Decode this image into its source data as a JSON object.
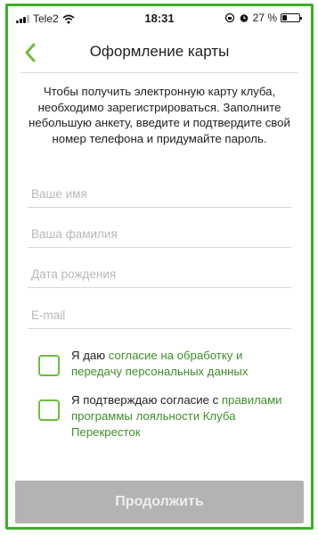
{
  "status_bar": {
    "carrier": "Tele2",
    "time": "18:31",
    "battery_percent": "27 %",
    "battery_level": 0.27,
    "icons": [
      "signal-icon",
      "wifi-icon",
      "rotation-lock-icon",
      "alarm-icon",
      "battery-icon"
    ]
  },
  "nav": {
    "title": "Оформление карты",
    "back_icon": "chevron-left-icon"
  },
  "intro_text": "Чтобы получить электронную карту клуба, необходимо зарегистрироваться. Заполните небольшую анкету, введите и подтвердите свой номер телефона и придумайте пароль.",
  "form": {
    "first_name": {
      "value": "",
      "placeholder": "Ваше имя"
    },
    "last_name": {
      "value": "",
      "placeholder": "Ваша фамилия"
    },
    "birth_date": {
      "value": "",
      "placeholder": "Дата рождения"
    },
    "email": {
      "value": "",
      "placeholder": "E-mail"
    }
  },
  "consents": {
    "personal_data": {
      "prefix": "Я даю ",
      "link": "согласие на обработку и передачу персональных данных",
      "checked": false
    },
    "loyalty_rules": {
      "prefix": "Я подтверждаю согласие с ",
      "link": "правилами программы лояльности Клуба Перекресток",
      "checked": false
    }
  },
  "continue_label": "Продолжить",
  "colors": {
    "accent": "#6cbf3a",
    "link": "#3f8f2a",
    "frame": "#3fae28",
    "button_disabled": "#b3b3b3"
  }
}
